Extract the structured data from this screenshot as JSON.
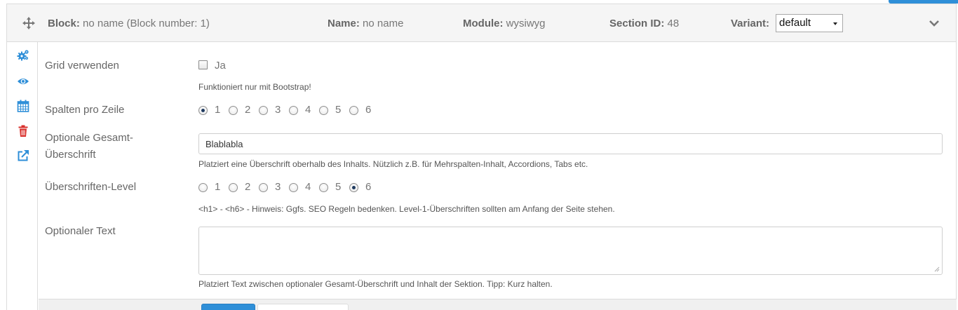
{
  "header": {
    "block_label": "Block:",
    "block_value": "no name (Block number: 1)",
    "name_label": "Name:",
    "name_value": "no name",
    "module_label": "Module:",
    "module_value": "wysiwyg",
    "section_label": "Section ID:",
    "section_value": "48",
    "variant_label": "Variant:",
    "variant_value": "default"
  },
  "sidebar": {
    "icons": [
      "settings-icon",
      "eye-icon",
      "calendar-icon",
      "trash-icon",
      "external-link-icon"
    ]
  },
  "form": {
    "grid": {
      "label": "Grid verwenden",
      "checkbox_label": "Ja",
      "help": "Funktioniert nur mit Bootstrap!"
    },
    "columns": {
      "label": "Spalten pro Zeile",
      "options": [
        "1",
        "2",
        "3",
        "4",
        "5",
        "6"
      ],
      "selected": "1"
    },
    "heading": {
      "label_line1": "Optionale Gesamt-",
      "label_line2": "Überschrift",
      "value": "Blablabla",
      "help": "Platziert eine Überschrift oberhalb des Inhalts. Nützlich z.B. für Mehrspalten-Inhalt, Accordions, Tabs etc."
    },
    "heading_level": {
      "label": "Überschriften-Level",
      "options": [
        "1",
        "2",
        "3",
        "4",
        "5",
        "6"
      ],
      "selected": "6",
      "help": "<h1> - <h6> - Hinweis: Ggfs. SEO Regeln bedenken. Level-1-Überschriften sollten am Anfang der Seite stehen."
    },
    "text": {
      "label": "Optionaler Text",
      "value": "",
      "help": "Platziert Text zwischen optionaler Gesamt-Überschrift und Inhalt der Sektion. Tipp: Kurz halten."
    }
  },
  "colors": {
    "primary": "#2f8fd8",
    "icon_blue": "#2f8fd8",
    "icon_red": "#d9302c",
    "border": "#dcdcdc",
    "header_bg": "#f5f5f5"
  }
}
